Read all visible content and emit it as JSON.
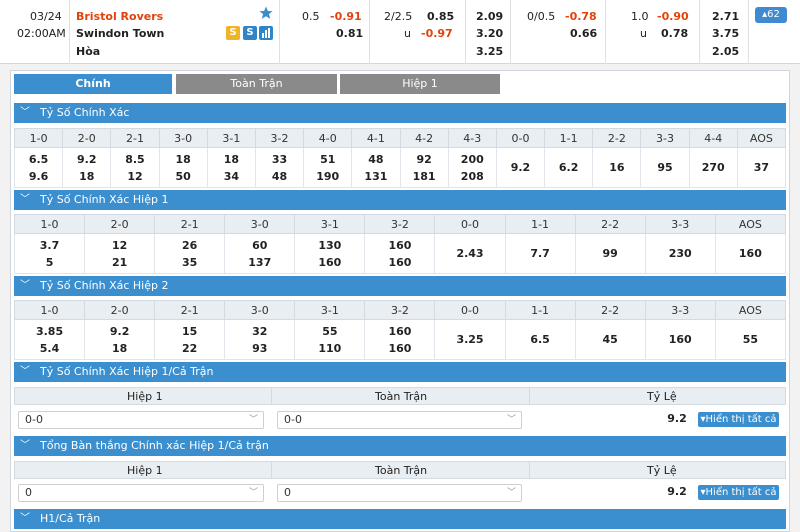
{
  "match": {
    "date": "03/24",
    "time": "02:00AM",
    "home": "Bristol Rovers",
    "away": "Swindon Town",
    "draw": "Hòa",
    "badge_s_gold": "S",
    "badge_s_blue": "S"
  },
  "odds": {
    "hdp_line": "0.5",
    "hdp_home": "-0.91",
    "hdp_away": "0.81",
    "ou_line": "2/2.5",
    "ou_over": "0.85",
    "ou_under_label": "u",
    "ou_under": "-0.97",
    "x12_home": "2.09",
    "x12_away": "3.20",
    "x12_draw": "3.25",
    "h1_hdp_line": "0/0.5",
    "h1_hdp_home": "-0.78",
    "h1_hdp_away": "0.66",
    "h1_ou_line": "1.0",
    "h1_ou_over": "-0.90",
    "h1_ou_under_label": "u",
    "h1_ou_under": "0.78",
    "h1_x12_home": "2.71",
    "h1_x12_away": "3.75",
    "h1_x12_draw": "2.05",
    "more": "▴62"
  },
  "tabs": [
    "Chính",
    "Toàn Trận",
    "Hiệp 1"
  ],
  "sections": {
    "s1": "Tỷ Số Chính Xác",
    "s2": "Tỷ Số Chính Xác Hiệp 1",
    "s3": "Tỷ Số Chính Xác Hiệp 2",
    "s4": "Tỷ Số Chính Xác Hiệp 1/Cả Trận",
    "s5": "Tổng Bàn thắng Chính xác Hiệp 1/Cả trận",
    "s6": "H1/Cả Trận"
  },
  "cs_full": {
    "headers": [
      "1-0",
      "2-0",
      "2-1",
      "3-0",
      "3-1",
      "3-2",
      "4-0",
      "4-1",
      "4-2",
      "4-3",
      "0-0",
      "1-1",
      "2-2",
      "3-3",
      "4-4",
      "AOS"
    ],
    "top": [
      "6.5",
      "9.2",
      "8.5",
      "18",
      "18",
      "33",
      "51",
      "48",
      "92",
      "200",
      "9.2",
      "6.2",
      "16",
      "95",
      "270",
      "37"
    ],
    "bottom": [
      "9.6",
      "18",
      "12",
      "50",
      "34",
      "48",
      "190",
      "131",
      "181",
      "208",
      "",
      "",
      "",
      "",
      "",
      ""
    ]
  },
  "cs_h1": {
    "headers": [
      "1-0",
      "2-0",
      "2-1",
      "3-0",
      "3-1",
      "3-2",
      "0-0",
      "1-1",
      "2-2",
      "3-3",
      "AOS"
    ],
    "top": [
      "3.7",
      "12",
      "26",
      "60",
      "130",
      "160",
      "2.43",
      "7.7",
      "99",
      "230",
      "160"
    ],
    "bottom": [
      "5",
      "21",
      "35",
      "137",
      "160",
      "160",
      "",
      "",
      "",
      "",
      ""
    ]
  },
  "cs_h2": {
    "headers": [
      "1-0",
      "2-0",
      "2-1",
      "3-0",
      "3-1",
      "3-2",
      "0-0",
      "1-1",
      "2-2",
      "3-3",
      "AOS"
    ],
    "top": [
      "3.85",
      "9.2",
      "15",
      "32",
      "55",
      "160",
      "3.25",
      "6.5",
      "45",
      "160",
      "55"
    ],
    "bottom": [
      "5.4",
      "18",
      "22",
      "93",
      "110",
      "160",
      "",
      "",
      "",
      "",
      ""
    ]
  },
  "htft": {
    "col1": "Hiệp 1",
    "col2": "Toàn Trận",
    "col3": "Tỷ Lệ",
    "sel1": "0-0",
    "sel2": "0-0",
    "ratio": "9.2",
    "show_all": "▾Hiển thị tất cả"
  },
  "totals": {
    "col1": "Hiệp 1",
    "col2": "Toàn Trận",
    "col3": "Tỷ Lệ",
    "sel1": "0",
    "sel2": "0",
    "ratio": "9.2",
    "show_all": "▾Hiển thị tất cả"
  },
  "colors": {
    "accent": "#3b8fcf",
    "negative": "#e2420b",
    "tab_inactive": "#8a8a8a"
  }
}
